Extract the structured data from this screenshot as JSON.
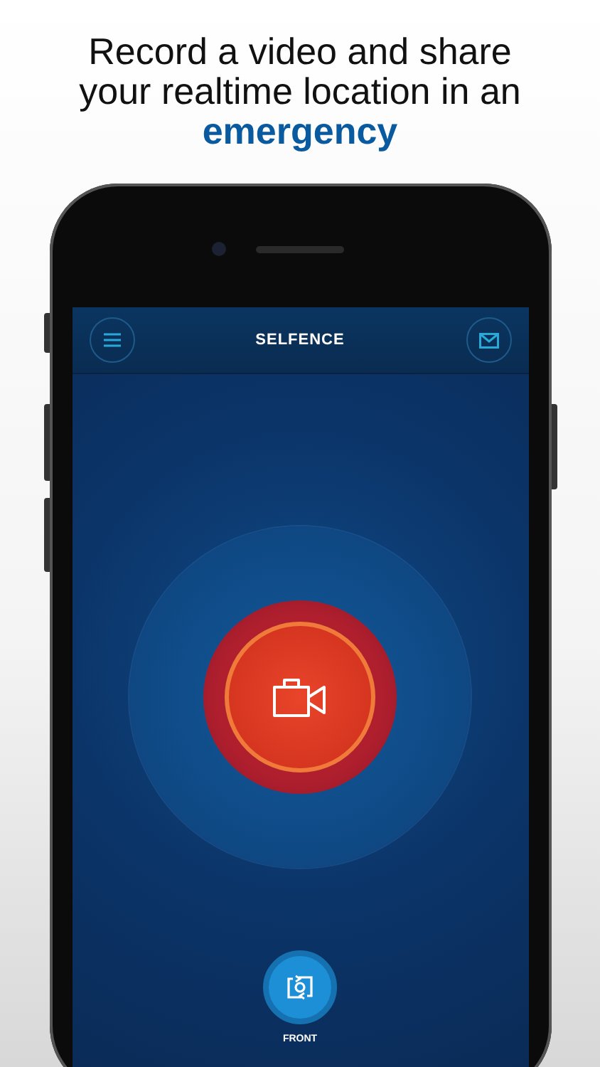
{
  "headline": "Record a video and share your realtime location in an **emergency**",
  "app": {
    "title": "SELFENCE",
    "camera_label": "FRONT"
  }
}
